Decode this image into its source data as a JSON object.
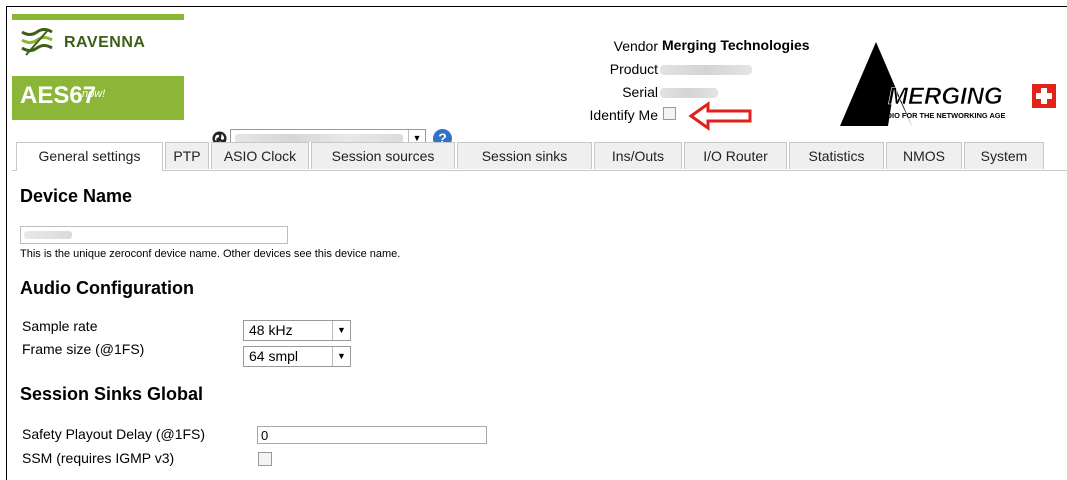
{
  "header": {
    "logo": {
      "ravenna": "RAVENNA",
      "aes67": "AES67",
      "now": "now!"
    },
    "vendor_label": "Vendor",
    "vendor_value": "Merging Technologies",
    "product_label": "Product",
    "serial_label": "Serial",
    "identify_label": "Identify Me",
    "identify_checked": false,
    "merging_logo": {
      "name": "MERGING",
      "tagline": "AUDIO FOR THE NETWORKING AGE"
    },
    "help_icon_glyph": "?"
  },
  "tabs": [
    {
      "label": "General settings",
      "active": true
    },
    {
      "label": "PTP"
    },
    {
      "label": "ASIO Clock"
    },
    {
      "label": "Session sources"
    },
    {
      "label": "Session sinks"
    },
    {
      "label": "Ins/Outs"
    },
    {
      "label": "I/O Router"
    },
    {
      "label": "Statistics"
    },
    {
      "label": "NMOS"
    },
    {
      "label": "System"
    }
  ],
  "device_name": {
    "title": "Device Name",
    "help": "This is the unique zeroconf device name. Other devices see this device name."
  },
  "audio_config": {
    "title": "Audio Configuration",
    "sample_rate_label": "Sample rate",
    "sample_rate_value": "48 kHz",
    "frame_size_label": "Frame size (@1FS)",
    "frame_size_value": "64 smpl"
  },
  "sinks_global": {
    "title": "Session Sinks Global",
    "safety_label": "Safety Playout Delay (@1FS)",
    "safety_value": "0",
    "ssm_label": "SSM (requires IGMP v3)",
    "ssm_checked": false
  },
  "colors": {
    "ravenna_green": "#8cb637",
    "annotation_red": "#e0201b",
    "help_blue": "#2f73c8",
    "merging_red": "#e2231a"
  }
}
